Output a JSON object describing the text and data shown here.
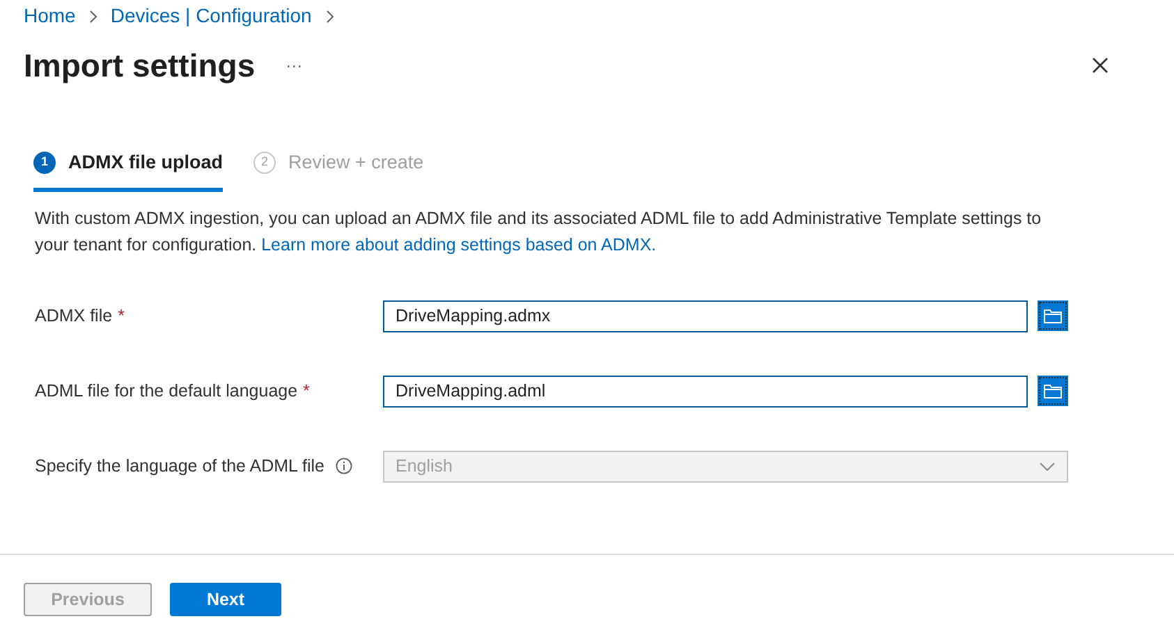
{
  "breadcrumb": [
    "Home",
    "Devices | Configuration"
  ],
  "title": "Import settings",
  "more_menu": "···",
  "steps": [
    {
      "number": "1",
      "label": "ADMX file upload",
      "selected": true
    },
    {
      "number": "2",
      "label": "Review + create",
      "selected": false
    }
  ],
  "description": {
    "text": "With custom ADMX ingestion, you can upload an ADMX file and its associated ADML file to add Administrative Template settings to your tenant for configuration.",
    "link": "Learn more about adding settings based on ADMX."
  },
  "fields": [
    {
      "kind": "file",
      "label": "ADMX file",
      "required_mark": "*",
      "value": "DriveMapping.admx"
    },
    {
      "kind": "file",
      "label": "ADML file for the default language",
      "required_mark": "*",
      "value": "DriveMapping.adml"
    },
    {
      "kind": "dropdown",
      "label": "Specify the language of the ADML file",
      "info": true,
      "value": "English",
      "disabled": true
    }
  ],
  "buttons": [
    {
      "label": "Previous",
      "kind": "secondary",
      "disabled": true
    },
    {
      "label": "Next",
      "kind": "primary",
      "disabled": false
    }
  ]
}
